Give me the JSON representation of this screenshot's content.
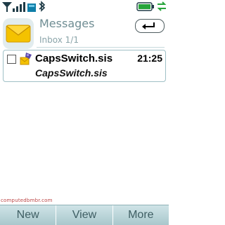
{
  "status": {
    "signal_icon": "signal-bars-icon",
    "network_icon": "network-bars-icon",
    "bluetooth_icon": "bluetooth-icon",
    "battery_icon": "battery-icon",
    "data_icon": "data-transfer-icon"
  },
  "header": {
    "title": "Messages",
    "subtitle": "Inbox 1/1",
    "mail_icon": "mail-envelope-icon",
    "back_icon": "back-arrow-icon"
  },
  "message": {
    "title": "CapsSwitch.sis",
    "time": "21:25",
    "subtitle": "CapsSwitch.sis",
    "icon": "sis-package-icon"
  },
  "watermark": "computedbmbr.com",
  "softkeys": {
    "left": "New",
    "center": "View",
    "right": "More"
  },
  "colors": {
    "accent": "#6f8d93",
    "softkey_bg": "#b9d6da",
    "envelope": "#f4c200"
  }
}
